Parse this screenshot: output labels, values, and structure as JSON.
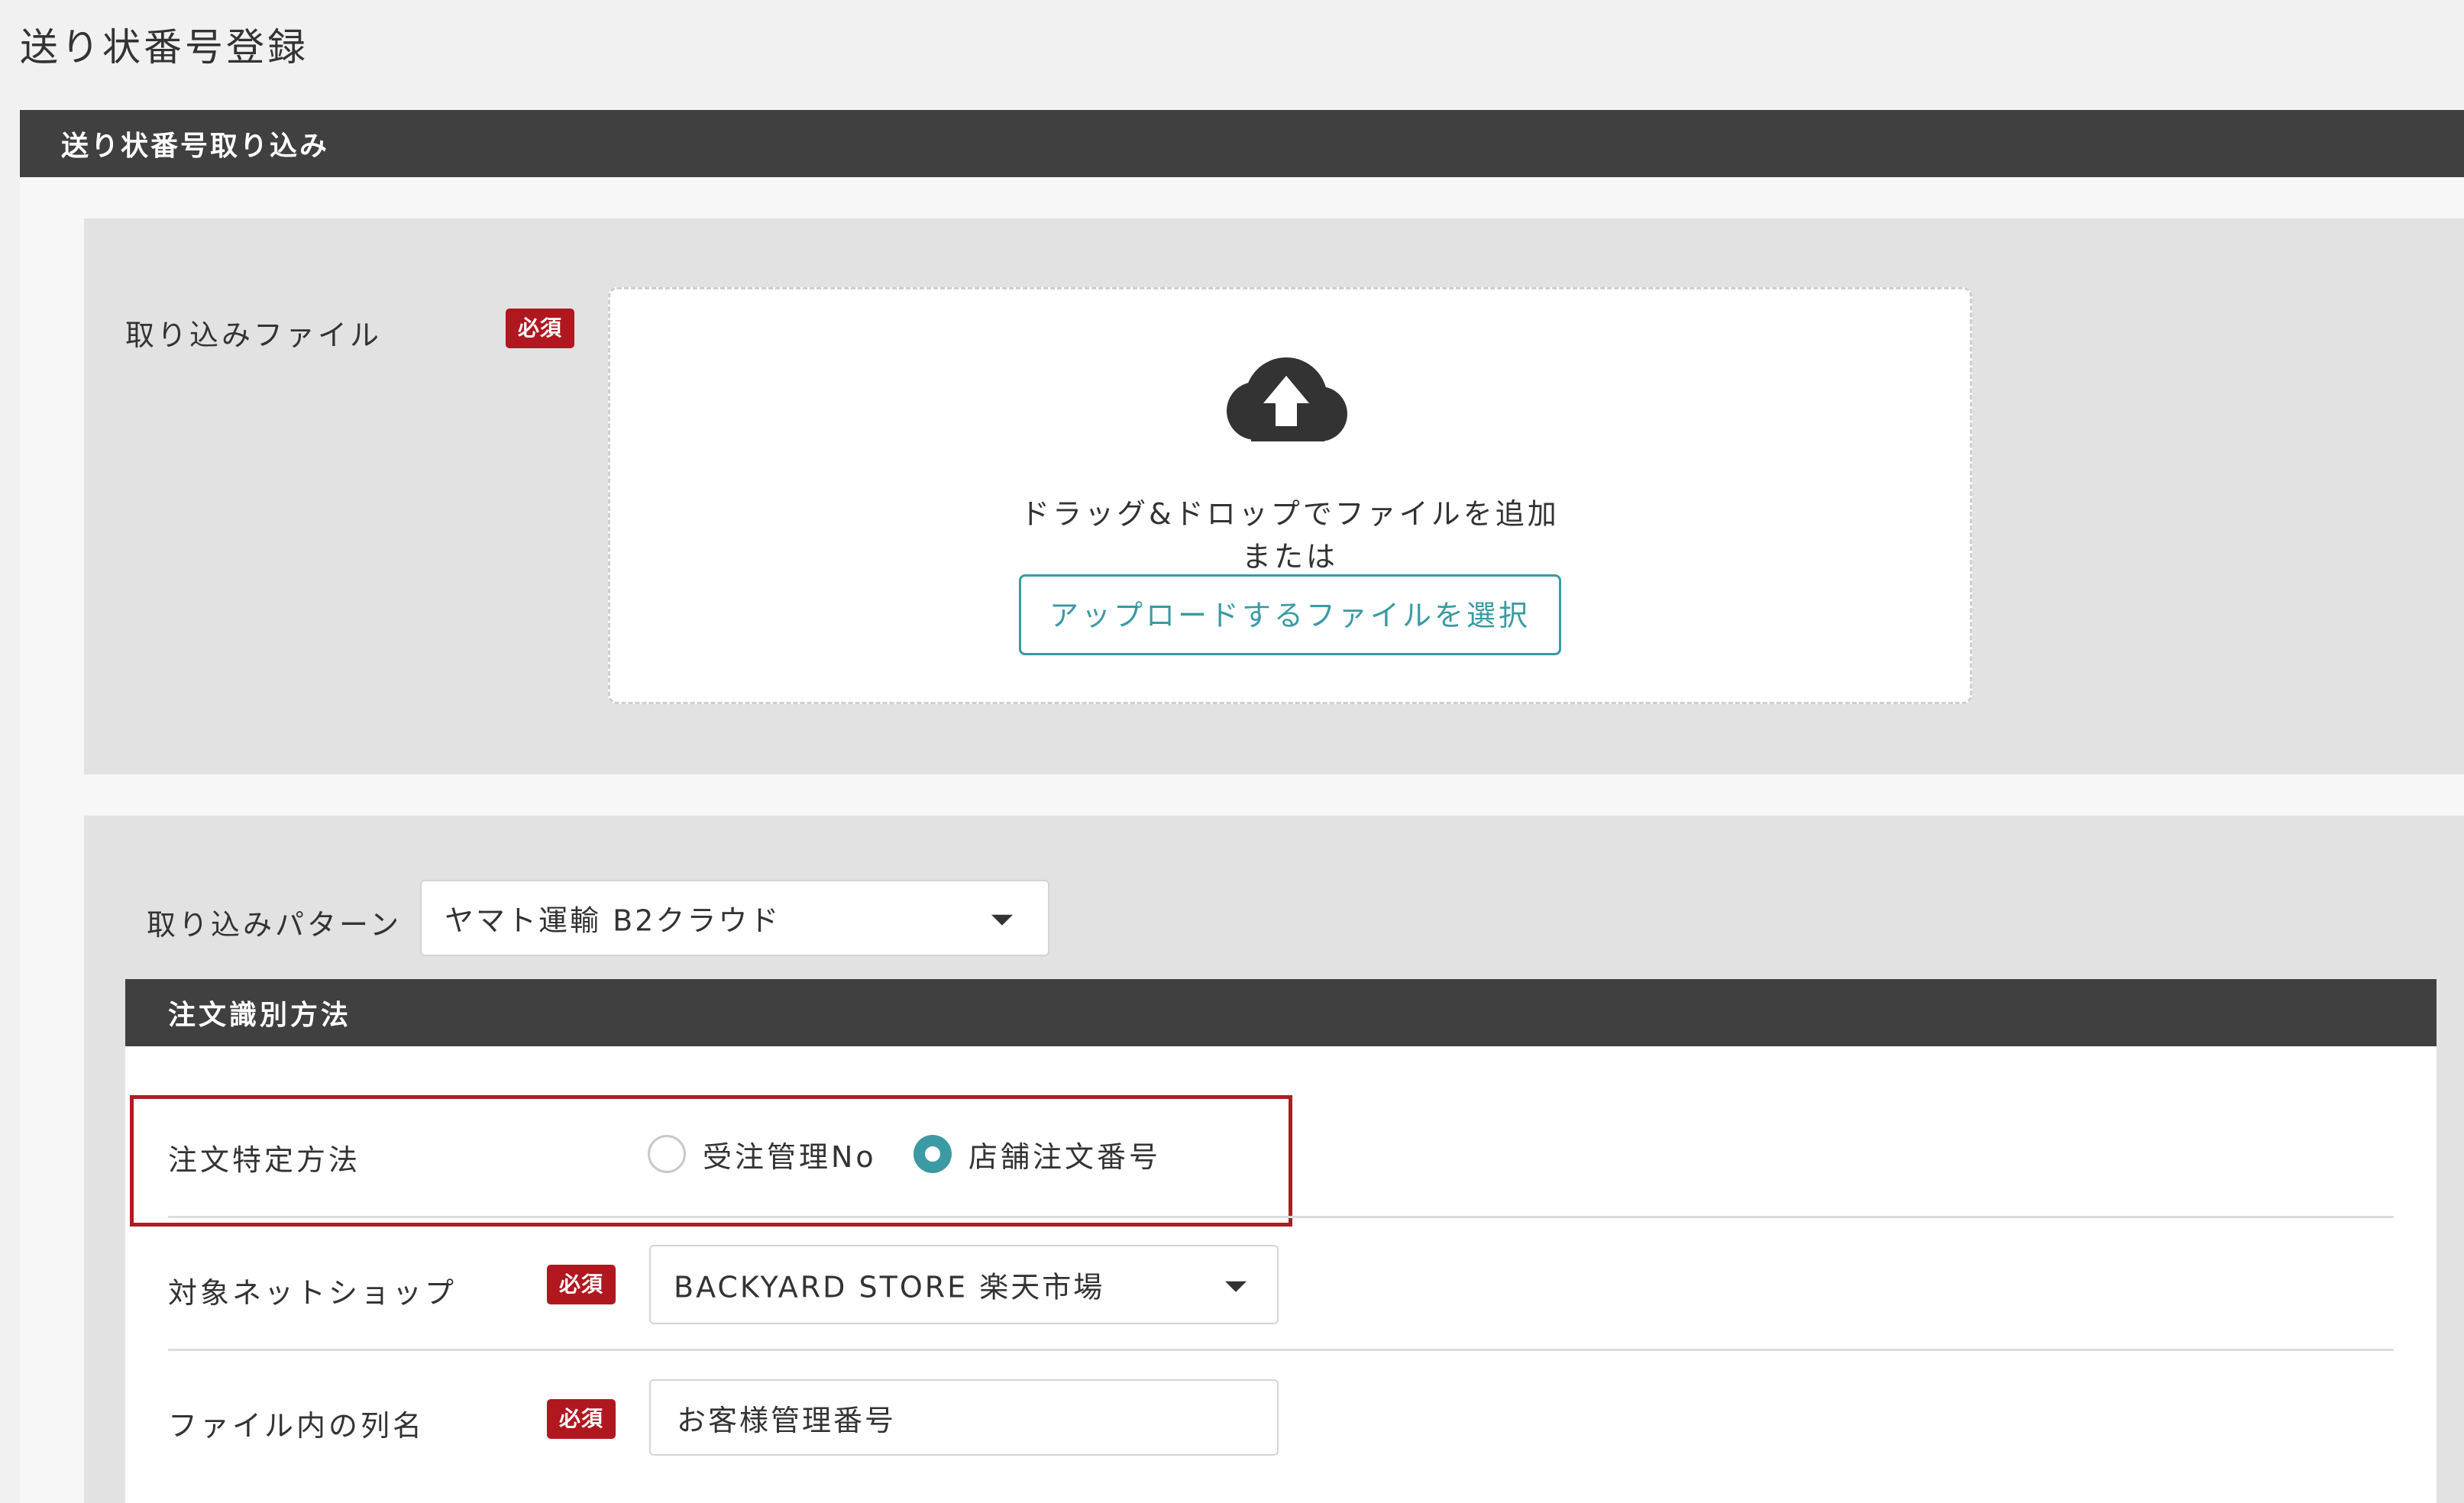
{
  "page": {
    "title": "送り状番号登録"
  },
  "import_section": {
    "title": "送り状番号取り込み"
  },
  "file_field": {
    "label": "取り込みファイル",
    "required_badge": "必須",
    "dropzone": {
      "icon": "cloud-upload-icon",
      "drag_text": "ドラッグ&ドロップでファイルを追加",
      "or_text": "または",
      "select_button_label": "アップロードするファイルを選択"
    }
  },
  "pattern_field": {
    "label": "取り込みパターン",
    "selected": "ヤマト運輸 B2クラウド"
  },
  "order_identification": {
    "title": "注文識別方法",
    "method": {
      "label": "注文特定方法",
      "options": [
        {
          "label": "受注管理No",
          "checked": false
        },
        {
          "label": "店舗注文番号",
          "checked": true
        }
      ]
    },
    "target_shop": {
      "label": "対象ネットショップ",
      "required_badge": "必須",
      "selected": "BACKYARD STORE 楽天市場"
    },
    "column_name": {
      "label": "ファイル内の列名",
      "required_badge": "必須",
      "value": "お客様管理番号"
    }
  },
  "colors": {
    "header_bar": "#404040",
    "accent_teal": "#3b9aa3",
    "required_red": "#b0171f",
    "highlight_red": "#b01c24"
  }
}
